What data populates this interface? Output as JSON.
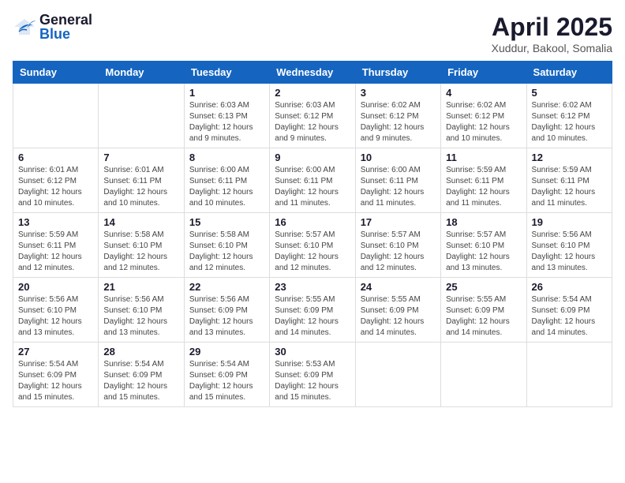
{
  "header": {
    "logo_general": "General",
    "logo_blue": "Blue",
    "title": "April 2025",
    "location": "Xuddur, Bakool, Somalia"
  },
  "weekdays": [
    "Sunday",
    "Monday",
    "Tuesday",
    "Wednesday",
    "Thursday",
    "Friday",
    "Saturday"
  ],
  "weeks": [
    [
      {
        "day": "",
        "info": ""
      },
      {
        "day": "",
        "info": ""
      },
      {
        "day": "1",
        "info": "Sunrise: 6:03 AM\nSunset: 6:13 PM\nDaylight: 12 hours\nand 9 minutes."
      },
      {
        "day": "2",
        "info": "Sunrise: 6:03 AM\nSunset: 6:12 PM\nDaylight: 12 hours\nand 9 minutes."
      },
      {
        "day": "3",
        "info": "Sunrise: 6:02 AM\nSunset: 6:12 PM\nDaylight: 12 hours\nand 9 minutes."
      },
      {
        "day": "4",
        "info": "Sunrise: 6:02 AM\nSunset: 6:12 PM\nDaylight: 12 hours\nand 10 minutes."
      },
      {
        "day": "5",
        "info": "Sunrise: 6:02 AM\nSunset: 6:12 PM\nDaylight: 12 hours\nand 10 minutes."
      }
    ],
    [
      {
        "day": "6",
        "info": "Sunrise: 6:01 AM\nSunset: 6:12 PM\nDaylight: 12 hours\nand 10 minutes."
      },
      {
        "day": "7",
        "info": "Sunrise: 6:01 AM\nSunset: 6:11 PM\nDaylight: 12 hours\nand 10 minutes."
      },
      {
        "day": "8",
        "info": "Sunrise: 6:00 AM\nSunset: 6:11 PM\nDaylight: 12 hours\nand 10 minutes."
      },
      {
        "day": "9",
        "info": "Sunrise: 6:00 AM\nSunset: 6:11 PM\nDaylight: 12 hours\nand 11 minutes."
      },
      {
        "day": "10",
        "info": "Sunrise: 6:00 AM\nSunset: 6:11 PM\nDaylight: 12 hours\nand 11 minutes."
      },
      {
        "day": "11",
        "info": "Sunrise: 5:59 AM\nSunset: 6:11 PM\nDaylight: 12 hours\nand 11 minutes."
      },
      {
        "day": "12",
        "info": "Sunrise: 5:59 AM\nSunset: 6:11 PM\nDaylight: 12 hours\nand 11 minutes."
      }
    ],
    [
      {
        "day": "13",
        "info": "Sunrise: 5:59 AM\nSunset: 6:11 PM\nDaylight: 12 hours\nand 12 minutes."
      },
      {
        "day": "14",
        "info": "Sunrise: 5:58 AM\nSunset: 6:10 PM\nDaylight: 12 hours\nand 12 minutes."
      },
      {
        "day": "15",
        "info": "Sunrise: 5:58 AM\nSunset: 6:10 PM\nDaylight: 12 hours\nand 12 minutes."
      },
      {
        "day": "16",
        "info": "Sunrise: 5:57 AM\nSunset: 6:10 PM\nDaylight: 12 hours\nand 12 minutes."
      },
      {
        "day": "17",
        "info": "Sunrise: 5:57 AM\nSunset: 6:10 PM\nDaylight: 12 hours\nand 12 minutes."
      },
      {
        "day": "18",
        "info": "Sunrise: 5:57 AM\nSunset: 6:10 PM\nDaylight: 12 hours\nand 13 minutes."
      },
      {
        "day": "19",
        "info": "Sunrise: 5:56 AM\nSunset: 6:10 PM\nDaylight: 12 hours\nand 13 minutes."
      }
    ],
    [
      {
        "day": "20",
        "info": "Sunrise: 5:56 AM\nSunset: 6:10 PM\nDaylight: 12 hours\nand 13 minutes."
      },
      {
        "day": "21",
        "info": "Sunrise: 5:56 AM\nSunset: 6:10 PM\nDaylight: 12 hours\nand 13 minutes."
      },
      {
        "day": "22",
        "info": "Sunrise: 5:56 AM\nSunset: 6:09 PM\nDaylight: 12 hours\nand 13 minutes."
      },
      {
        "day": "23",
        "info": "Sunrise: 5:55 AM\nSunset: 6:09 PM\nDaylight: 12 hours\nand 14 minutes."
      },
      {
        "day": "24",
        "info": "Sunrise: 5:55 AM\nSunset: 6:09 PM\nDaylight: 12 hours\nand 14 minutes."
      },
      {
        "day": "25",
        "info": "Sunrise: 5:55 AM\nSunset: 6:09 PM\nDaylight: 12 hours\nand 14 minutes."
      },
      {
        "day": "26",
        "info": "Sunrise: 5:54 AM\nSunset: 6:09 PM\nDaylight: 12 hours\nand 14 minutes."
      }
    ],
    [
      {
        "day": "27",
        "info": "Sunrise: 5:54 AM\nSunset: 6:09 PM\nDaylight: 12 hours\nand 15 minutes."
      },
      {
        "day": "28",
        "info": "Sunrise: 5:54 AM\nSunset: 6:09 PM\nDaylight: 12 hours\nand 15 minutes."
      },
      {
        "day": "29",
        "info": "Sunrise: 5:54 AM\nSunset: 6:09 PM\nDaylight: 12 hours\nand 15 minutes."
      },
      {
        "day": "30",
        "info": "Sunrise: 5:53 AM\nSunset: 6:09 PM\nDaylight: 12 hours\nand 15 minutes."
      },
      {
        "day": "",
        "info": ""
      },
      {
        "day": "",
        "info": ""
      },
      {
        "day": "",
        "info": ""
      }
    ]
  ]
}
